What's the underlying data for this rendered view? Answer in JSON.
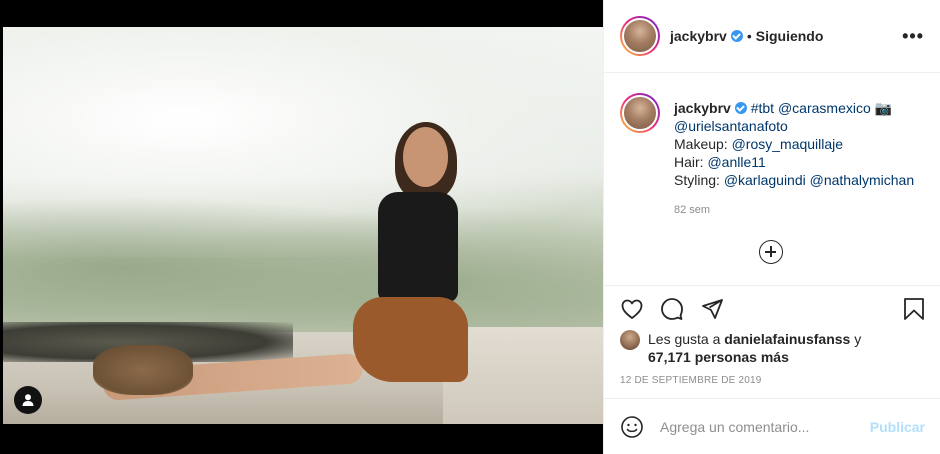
{
  "post": {
    "username": "jackybrv",
    "separator": "•",
    "follow_status": "Siguiendo",
    "more_label": "•••",
    "caption": {
      "username": "jackybrv",
      "line1_tags": "#tbt @carasmexico",
      "camera_glyph": "📷",
      "line2": "@urielsantanafoto",
      "makeup_label": "Makeup: ",
      "makeup_tag": "@rosy_maquillaje",
      "hair_label": "Hair: ",
      "hair_tag": "@anlle11",
      "styling_label": "Styling: ",
      "styling_tags": "@karlaguindi @nathalymichan",
      "age": "82 sem"
    },
    "likes": {
      "prefix": "Les gusta a ",
      "user": "danielafainusfanss",
      "connector": " y",
      "count": "67,171 personas más"
    },
    "date": "12 DE SEPTIEMBRE DE 2019",
    "comment_placeholder": "Agrega un comentario...",
    "publish_label": "Publicar"
  },
  "colors": {
    "link": "#00376b",
    "verified": "#3897f0",
    "publish_disabled": "#b2dffc",
    "muted": "#8e8e8e"
  },
  "icons": {
    "header_more": "more-options-icon",
    "add_comment": "plus-circle-icon",
    "like": "heart-icon",
    "comment": "comment-bubble-icon",
    "share": "paper-plane-icon",
    "save": "bookmark-icon",
    "emoji": "smiley-icon",
    "tagged_users": "person-tag-icon",
    "verified": "verified-badge-icon"
  }
}
